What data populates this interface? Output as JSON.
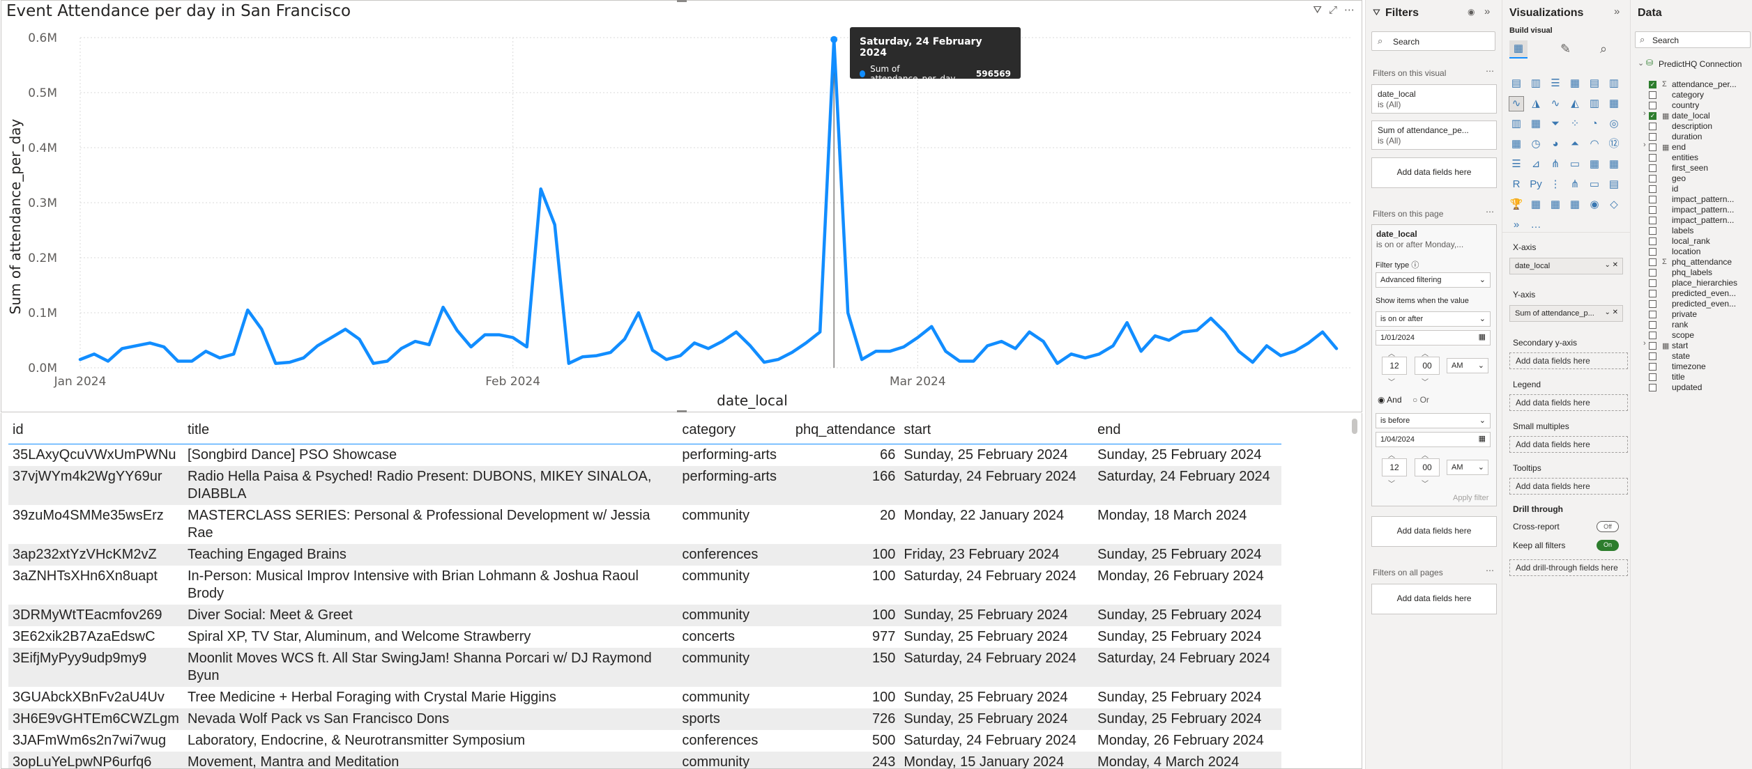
{
  "chart": {
    "title": "Event Attendance per day in San Francisco",
    "tooltip": {
      "date": "Saturday, 24 February 2024",
      "series": "Sum of attendance_per_day",
      "value": "596569"
    }
  },
  "chart_data": {
    "type": "line",
    "title": "Event Attendance per day in San Francisco",
    "xlabel": "date_local",
    "ylabel": "Sum of attendance_per_day",
    "x_ticks": [
      "Jan 2024",
      "Feb 2024",
      "Mar 2024"
    ],
    "y_ticks": [
      "0.0M",
      "0.1M",
      "0.2M",
      "0.3M",
      "0.4M",
      "0.5M",
      "0.6M"
    ],
    "x_range": [
      "2024-01-01",
      "2024-04-01"
    ],
    "ylim": [
      0,
      600000
    ],
    "grid": true,
    "color": "#118dff",
    "series": [
      {
        "name": "Sum of attendance_per_day",
        "x": [
          "2024-01-01",
          "2024-01-02",
          "2024-01-03",
          "2024-01-04",
          "2024-01-05",
          "2024-01-06",
          "2024-01-07",
          "2024-01-08",
          "2024-01-09",
          "2024-01-10",
          "2024-01-11",
          "2024-01-12",
          "2024-01-13",
          "2024-01-14",
          "2024-01-15",
          "2024-01-16",
          "2024-01-17",
          "2024-01-18",
          "2024-01-19",
          "2024-01-20",
          "2024-01-21",
          "2024-01-22",
          "2024-01-23",
          "2024-01-24",
          "2024-01-25",
          "2024-01-26",
          "2024-01-27",
          "2024-01-28",
          "2024-01-29",
          "2024-01-30",
          "2024-01-31",
          "2024-02-01",
          "2024-02-02",
          "2024-02-03",
          "2024-02-04",
          "2024-02-05",
          "2024-02-06",
          "2024-02-07",
          "2024-02-08",
          "2024-02-09",
          "2024-02-10",
          "2024-02-11",
          "2024-02-12",
          "2024-02-13",
          "2024-02-14",
          "2024-02-15",
          "2024-02-16",
          "2024-02-17",
          "2024-02-18",
          "2024-02-19",
          "2024-02-20",
          "2024-02-21",
          "2024-02-22",
          "2024-02-23",
          "2024-02-24",
          "2024-02-25",
          "2024-02-26",
          "2024-02-27",
          "2024-02-28",
          "2024-02-29",
          "2024-03-01",
          "2024-03-02",
          "2024-03-03",
          "2024-03-04",
          "2024-03-05",
          "2024-03-06",
          "2024-03-07",
          "2024-03-08",
          "2024-03-09",
          "2024-03-10",
          "2024-03-11",
          "2024-03-12",
          "2024-03-13",
          "2024-03-14",
          "2024-03-15",
          "2024-03-16",
          "2024-03-17",
          "2024-03-18",
          "2024-03-19",
          "2024-03-20",
          "2024-03-21",
          "2024-03-22",
          "2024-03-23",
          "2024-03-24",
          "2024-03-25",
          "2024-03-26",
          "2024-03-27",
          "2024-03-28",
          "2024-03-29",
          "2024-03-30",
          "2024-03-31"
        ],
        "values": [
          15000,
          25000,
          12000,
          35000,
          40000,
          45000,
          38000,
          12000,
          12000,
          30000,
          18000,
          25000,
          105000,
          70000,
          8000,
          10000,
          18000,
          40000,
          55000,
          70000,
          52000,
          8000,
          12000,
          35000,
          48000,
          42000,
          110000,
          68000,
          38000,
          60000,
          60000,
          55000,
          38000,
          325000,
          260000,
          8000,
          20000,
          22000,
          28000,
          52000,
          100000,
          32000,
          15000,
          22000,
          45000,
          35000,
          48000,
          65000,
          40000,
          10000,
          15000,
          28000,
          45000,
          65000,
          596569,
          100000,
          15000,
          30000,
          30000,
          38000,
          55000,
          75000,
          30000,
          12000,
          12000,
          40000,
          48000,
          35000,
          65000,
          48000,
          8000,
          25000,
          18000,
          25000,
          40000,
          82000,
          30000,
          58000,
          50000,
          65000,
          68000,
          90000,
          65000,
          30000,
          10000,
          40000,
          22000,
          30000,
          45000,
          65000,
          35000
        ]
      }
    ]
  },
  "table": {
    "headers": {
      "id": "id",
      "title": "title",
      "category": "category",
      "phq_attendance": "phq_attendance",
      "start": "start",
      "end": "end"
    },
    "rows": [
      {
        "id": "35LAxyQcuVWxUmPWNu",
        "title": "[Songbird Dance] PSO Showcase",
        "category": "performing-arts",
        "phq_attendance": "66",
        "start": "Sunday, 25 February 2024",
        "end": "Sunday, 25 February 2024"
      },
      {
        "id": "37vjWYm4k2WgYY69ur",
        "title": "Radio Hella Paisa & Psyched! Radio Present: DUBONS, MIKEY SINALOA, DIABBLA",
        "category": "performing-arts",
        "phq_attendance": "166",
        "start": "Saturday, 24 February 2024",
        "end": "Saturday, 24 February 2024"
      },
      {
        "id": "39zuMo4SMMe35wsErz",
        "title": "MASTERCLASS SERIES: Personal & Professional Development w/ Jessia Rae",
        "category": "community",
        "phq_attendance": "20",
        "start": "Monday, 22 January 2024",
        "end": "Monday, 18 March 2024"
      },
      {
        "id": "3ap232xtYzVHcKM2vZ",
        "title": "Teaching Engaged Brains",
        "category": "conferences",
        "phq_attendance": "100",
        "start": "Friday, 23 February 2024",
        "end": "Sunday, 25 February 2024"
      },
      {
        "id": "3aZNHTsXHn6Xn8uapt",
        "title": "In-Person: Musical Improv Intensive with Brian Lohmann & Joshua Raoul Brody",
        "category": "community",
        "phq_attendance": "100",
        "start": "Saturday, 24 February 2024",
        "end": "Monday, 26 February 2024"
      },
      {
        "id": "3DRMyWtTEacmfov269",
        "title": "Diver Social: Meet & Greet",
        "category": "community",
        "phq_attendance": "100",
        "start": "Sunday, 25 February 2024",
        "end": "Sunday, 25 February 2024"
      },
      {
        "id": "3E62xik2B7AzaEdswC",
        "title": "Spiral XP, TV Star, Aluminum, and Welcome Strawberry",
        "category": "concerts",
        "phq_attendance": "977",
        "start": "Sunday, 25 February 2024",
        "end": "Sunday, 25 February 2024"
      },
      {
        "id": "3EifjMyPyy9udp9my9",
        "title": "Moonlit Moves WCS ft. All Star SwingJam! Shanna Porcari w/ DJ Raymond Byun",
        "category": "community",
        "phq_attendance": "150",
        "start": "Saturday, 24 February 2024",
        "end": "Saturday, 24 February 2024"
      },
      {
        "id": "3GUAbckXBnFv2aU4Uv",
        "title": "Tree Medicine + Herbal Foraging with Crystal Marie Higgins",
        "category": "community",
        "phq_attendance": "100",
        "start": "Sunday, 25 February 2024",
        "end": "Sunday, 25 February 2024"
      },
      {
        "id": "3H6E9vGHTEm6CWZLgm",
        "title": "Nevada Wolf Pack vs San Francisco Dons",
        "category": "sports",
        "phq_attendance": "726",
        "start": "Sunday, 25 February 2024",
        "end": "Sunday, 25 February 2024"
      },
      {
        "id": "3JAFmWm6s2n7wi7wug",
        "title": "Laboratory, Endocrine, & Neurotransmitter Symposium",
        "category": "conferences",
        "phq_attendance": "500",
        "start": "Saturday, 24 February 2024",
        "end": "Monday, 26 February 2024"
      },
      {
        "id": "3opLuYeLpwNP6urfq6",
        "title": "Movement, Mantra and Meditation",
        "category": "community",
        "phq_attendance": "243",
        "start": "Monday, 15 January 2024",
        "end": "Monday, 4 March 2024"
      }
    ]
  },
  "filters": {
    "title": "Filters",
    "search_placeholder": "Search",
    "on_this_visual": "Filters on this visual",
    "visual_filters": [
      {
        "name": "date_local",
        "value": "is (All)"
      },
      {
        "name": "Sum of attendance_pe...",
        "value": "is (All)"
      }
    ],
    "add_fields": "Add data fields here",
    "on_this_page": "Filters on this page",
    "page_filter": {
      "name": "date_local",
      "summary": "is on or after Monday,...",
      "filter_type_label": "Filter type",
      "filter_type": "Advanced filtering",
      "show_items": "Show items when the value",
      "cond1": "is on or after",
      "date1": "1/01/2024",
      "hour1": "12",
      "min1": "00",
      "ampm1": "AM",
      "and_label": "And",
      "or_label": "Or",
      "cond2": "is before",
      "date2": "1/04/2024",
      "hour2": "12",
      "min2": "00",
      "ampm2": "AM",
      "apply": "Apply filter"
    },
    "on_all_pages": "Filters on all pages"
  },
  "visualizations": {
    "title": "Visualizations",
    "build_visual": "Build visual",
    "x_axis": "X-axis",
    "x_field": "date_local",
    "y_axis": "Y-axis",
    "y_field": "Sum of attendance_p...",
    "secondary_y": "Secondary y-axis",
    "legend": "Legend",
    "small_multiples": "Small multiples",
    "tooltips": "Tooltips",
    "add_fields": "Add data fields here",
    "drill_through": "Drill through",
    "cross_report": "Cross-report",
    "cross_report_state": "Off",
    "keep_all_filters": "Keep all filters",
    "keep_all_state": "On",
    "add_drill": "Add drill-through fields here",
    "icon_glyphs": [
      "▤",
      "▥",
      "☰",
      "▦",
      "▤",
      "▥",
      "∿",
      "◮",
      "∿",
      "◭",
      "▥",
      "▦",
      "▥",
      "▦",
      "⏷",
      "⁘",
      "◔",
      "◎",
      "▦",
      "◷",
      "◕",
      "⏶",
      "◠",
      "⑫",
      "☰",
      "⊿",
      "⋔",
      "▭",
      "▦",
      "▦",
      "R",
      "Py",
      "⋮",
      "⋔",
      "▭",
      "▤",
      "🏆",
      "▦",
      "▦",
      "▦",
      "◉",
      "◇",
      "»",
      "…"
    ]
  },
  "data": {
    "title": "Data",
    "search_placeholder": "Search",
    "connection": "PredictHQ Connection",
    "fields": [
      {
        "name": "attendance_per...",
        "sigma": true,
        "checked": true
      },
      {
        "name": "category"
      },
      {
        "name": "country"
      },
      {
        "name": "date_local",
        "checked": true,
        "table": true,
        "expand": true
      },
      {
        "name": "description"
      },
      {
        "name": "duration"
      },
      {
        "name": "end",
        "table": true,
        "expand": true
      },
      {
        "name": "entities"
      },
      {
        "name": "first_seen"
      },
      {
        "name": "geo"
      },
      {
        "name": "id"
      },
      {
        "name": "impact_pattern..."
      },
      {
        "name": "impact_pattern..."
      },
      {
        "name": "impact_pattern..."
      },
      {
        "name": "labels"
      },
      {
        "name": "local_rank"
      },
      {
        "name": "location"
      },
      {
        "name": "phq_attendance",
        "sigma": true
      },
      {
        "name": "phq_labels"
      },
      {
        "name": "place_hierarchies"
      },
      {
        "name": "predicted_even..."
      },
      {
        "name": "predicted_even..."
      },
      {
        "name": "private"
      },
      {
        "name": "rank"
      },
      {
        "name": "scope"
      },
      {
        "name": "start",
        "table": true,
        "expand": true
      },
      {
        "name": "state"
      },
      {
        "name": "timezone"
      },
      {
        "name": "title"
      },
      {
        "name": "updated"
      }
    ]
  }
}
